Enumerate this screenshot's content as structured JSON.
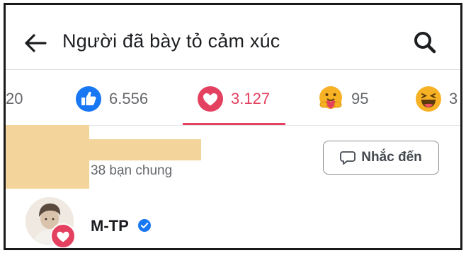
{
  "header": {
    "title": "Người đã bày tỏ cảm xúc",
    "back_icon": "back-arrow-icon",
    "search_icon": "search-icon"
  },
  "tabs": [
    {
      "icon": "",
      "count": "20",
      "active": false
    },
    {
      "icon": "like-reaction-icon",
      "count": "6.556",
      "active": false
    },
    {
      "icon": "love-reaction-icon",
      "count": "3.127",
      "active": true
    },
    {
      "icon": "care-reaction-icon",
      "count": "95",
      "active": false
    },
    {
      "icon": "haha-reaction-icon",
      "count": "3",
      "active": false
    }
  ],
  "people": [
    {
      "name": "",
      "mutual": "38 bạn chung",
      "action_label": "Nhắc đến",
      "action_icon": "chat-bubble-icon",
      "redacted": true
    },
    {
      "name": "M-TP",
      "verified": true,
      "reaction_badge": "love-reaction-icon",
      "avatar": "user-avatar"
    }
  ],
  "colors": {
    "love": "#e4405f",
    "like": "#1877f2",
    "muted": "#65676b",
    "redaction": "#f3d49a"
  }
}
